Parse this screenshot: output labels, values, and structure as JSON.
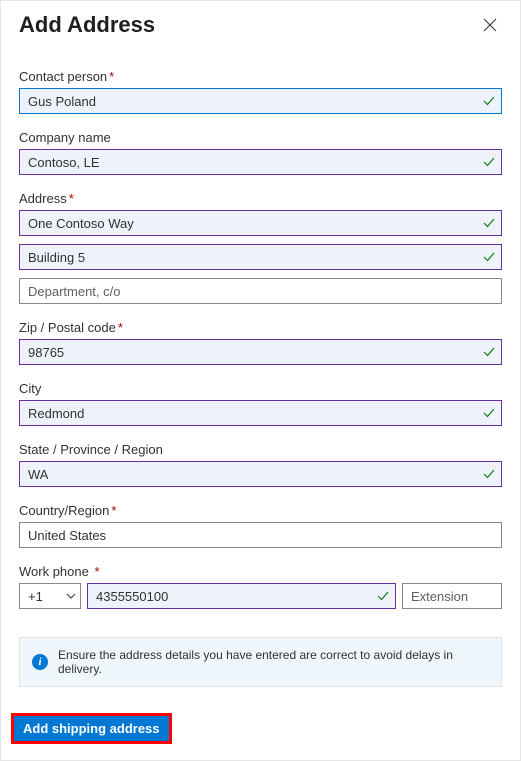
{
  "title": "Add Address",
  "labels": {
    "contact_person": "Contact person",
    "company_name": "Company name",
    "address": "Address",
    "zip": "Zip / Postal code",
    "city": "City",
    "state": "State / Province / Region",
    "country": "Country/Region",
    "work_phone": "Work phone"
  },
  "required_mark": "*",
  "fields": {
    "contact_person": "Gus Poland",
    "company_name": "Contoso, LE",
    "address_line1": "One Contoso Way",
    "address_line2": "Building 5",
    "address_line3_placeholder": "Department, c/o",
    "zip": "98765",
    "city": "Redmond",
    "state": "WA",
    "country": "United States",
    "phone_cc": "+1",
    "phone_number": "4355550100",
    "phone_ext_placeholder": "Extension"
  },
  "notice": "Ensure the address details you have entered are correct to avoid delays in delivery.",
  "submit_label": "Add shipping address"
}
